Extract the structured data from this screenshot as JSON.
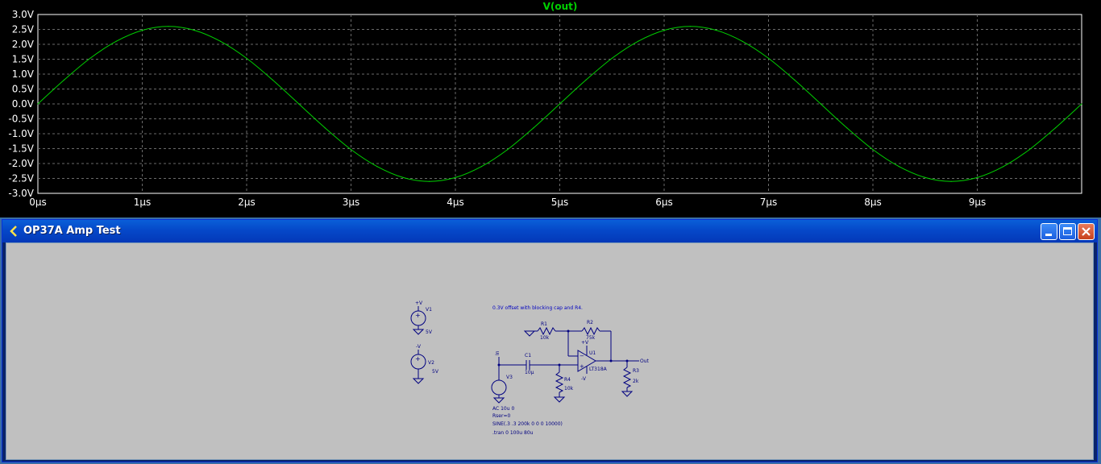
{
  "waveform": {
    "trace_title": "V(out)",
    "colors": {
      "background": "#000000",
      "trace": "#00d000",
      "frame": "#ffffff",
      "grid": "#6a6a6a"
    },
    "chart_data": {
      "type": "line",
      "title": "V(out)",
      "xlabel": "",
      "ylabel": "",
      "xlim": [
        0,
        10
      ],
      "ylim": [
        -3.0,
        3.0
      ],
      "grid": true,
      "x_tick_labels": [
        "0µs",
        "1µs",
        "2µs",
        "3µs",
        "4µs",
        "5µs",
        "6µs",
        "7µs",
        "8µs",
        "9µs"
      ],
      "y_tick_labels": [
        "3.0V",
        "2.5V",
        "2.0V",
        "1.5V",
        "1.0V",
        "0.5V",
        "0.0V",
        "-0.5V",
        "-1.0V",
        "-1.5V",
        "-2.0V",
        "-2.5V",
        "-3.0V"
      ],
      "series": [
        {
          "name": "V(out)",
          "x_unit": "µs",
          "y_unit": "V",
          "x": [
            0,
            0.25,
            0.5,
            0.75,
            1.0,
            1.25,
            1.5,
            1.75,
            2.0,
            2.25,
            2.5,
            2.75,
            3.0,
            3.25,
            3.5,
            3.75,
            4.0,
            4.25,
            4.5,
            4.75,
            5.0,
            5.25,
            5.5,
            5.75,
            6.0,
            6.25,
            6.5,
            6.75,
            7.0,
            7.25,
            7.5,
            7.75,
            8.0,
            8.25,
            8.5,
            8.75,
            9.0,
            9.25,
            9.5,
            9.75,
            10.0
          ],
          "y": [
            0.0,
            0.8,
            1.53,
            2.1,
            2.47,
            2.6,
            2.47,
            2.1,
            1.53,
            0.8,
            0.0,
            -0.8,
            -1.53,
            -2.1,
            -2.47,
            -2.6,
            -2.47,
            -2.1,
            -1.53,
            -0.8,
            0.0,
            0.8,
            1.53,
            2.1,
            2.47,
            2.6,
            2.47,
            2.1,
            1.53,
            0.8,
            0.0,
            -0.8,
            -1.53,
            -2.1,
            -2.47,
            -2.6,
            -2.47,
            -2.1,
            -1.53,
            -0.8,
            -0.0
          ]
        }
      ]
    }
  },
  "schematic_window": {
    "title": "OP37A Amp Test",
    "buttons": {
      "minimize": "minimize",
      "maximize": "maximize",
      "close": "close"
    },
    "schematic": {
      "comment": "0.3V offset with blocking cap and R4.",
      "v1": {
        "name": "V1",
        "net": "+V",
        "value": "5V"
      },
      "v2": {
        "name": "V2",
        "net": "-V",
        "value": "5V"
      },
      "v3": {
        "name": "V3",
        "net": "In"
      },
      "r1": {
        "name": "R1",
        "value": "10k"
      },
      "r2": {
        "name": "R2",
        "value": "75k"
      },
      "r3": {
        "name": "R3",
        "value": "2k"
      },
      "r4": {
        "name": "R4",
        "value": "10k"
      },
      "c1": {
        "name": "C1",
        "value": "10µ"
      },
      "u1": {
        "name": "U1",
        "part": "LT318A",
        "pos_supply": "+V",
        "neg_supply": "-V"
      },
      "out_label": "Out",
      "v3_spec": [
        "AC 10u 0",
        "Rser=0",
        "SINE(.3 .3 200k 0 0 0 10000)"
      ],
      "directive": ".tran 0 100u 80u"
    }
  }
}
